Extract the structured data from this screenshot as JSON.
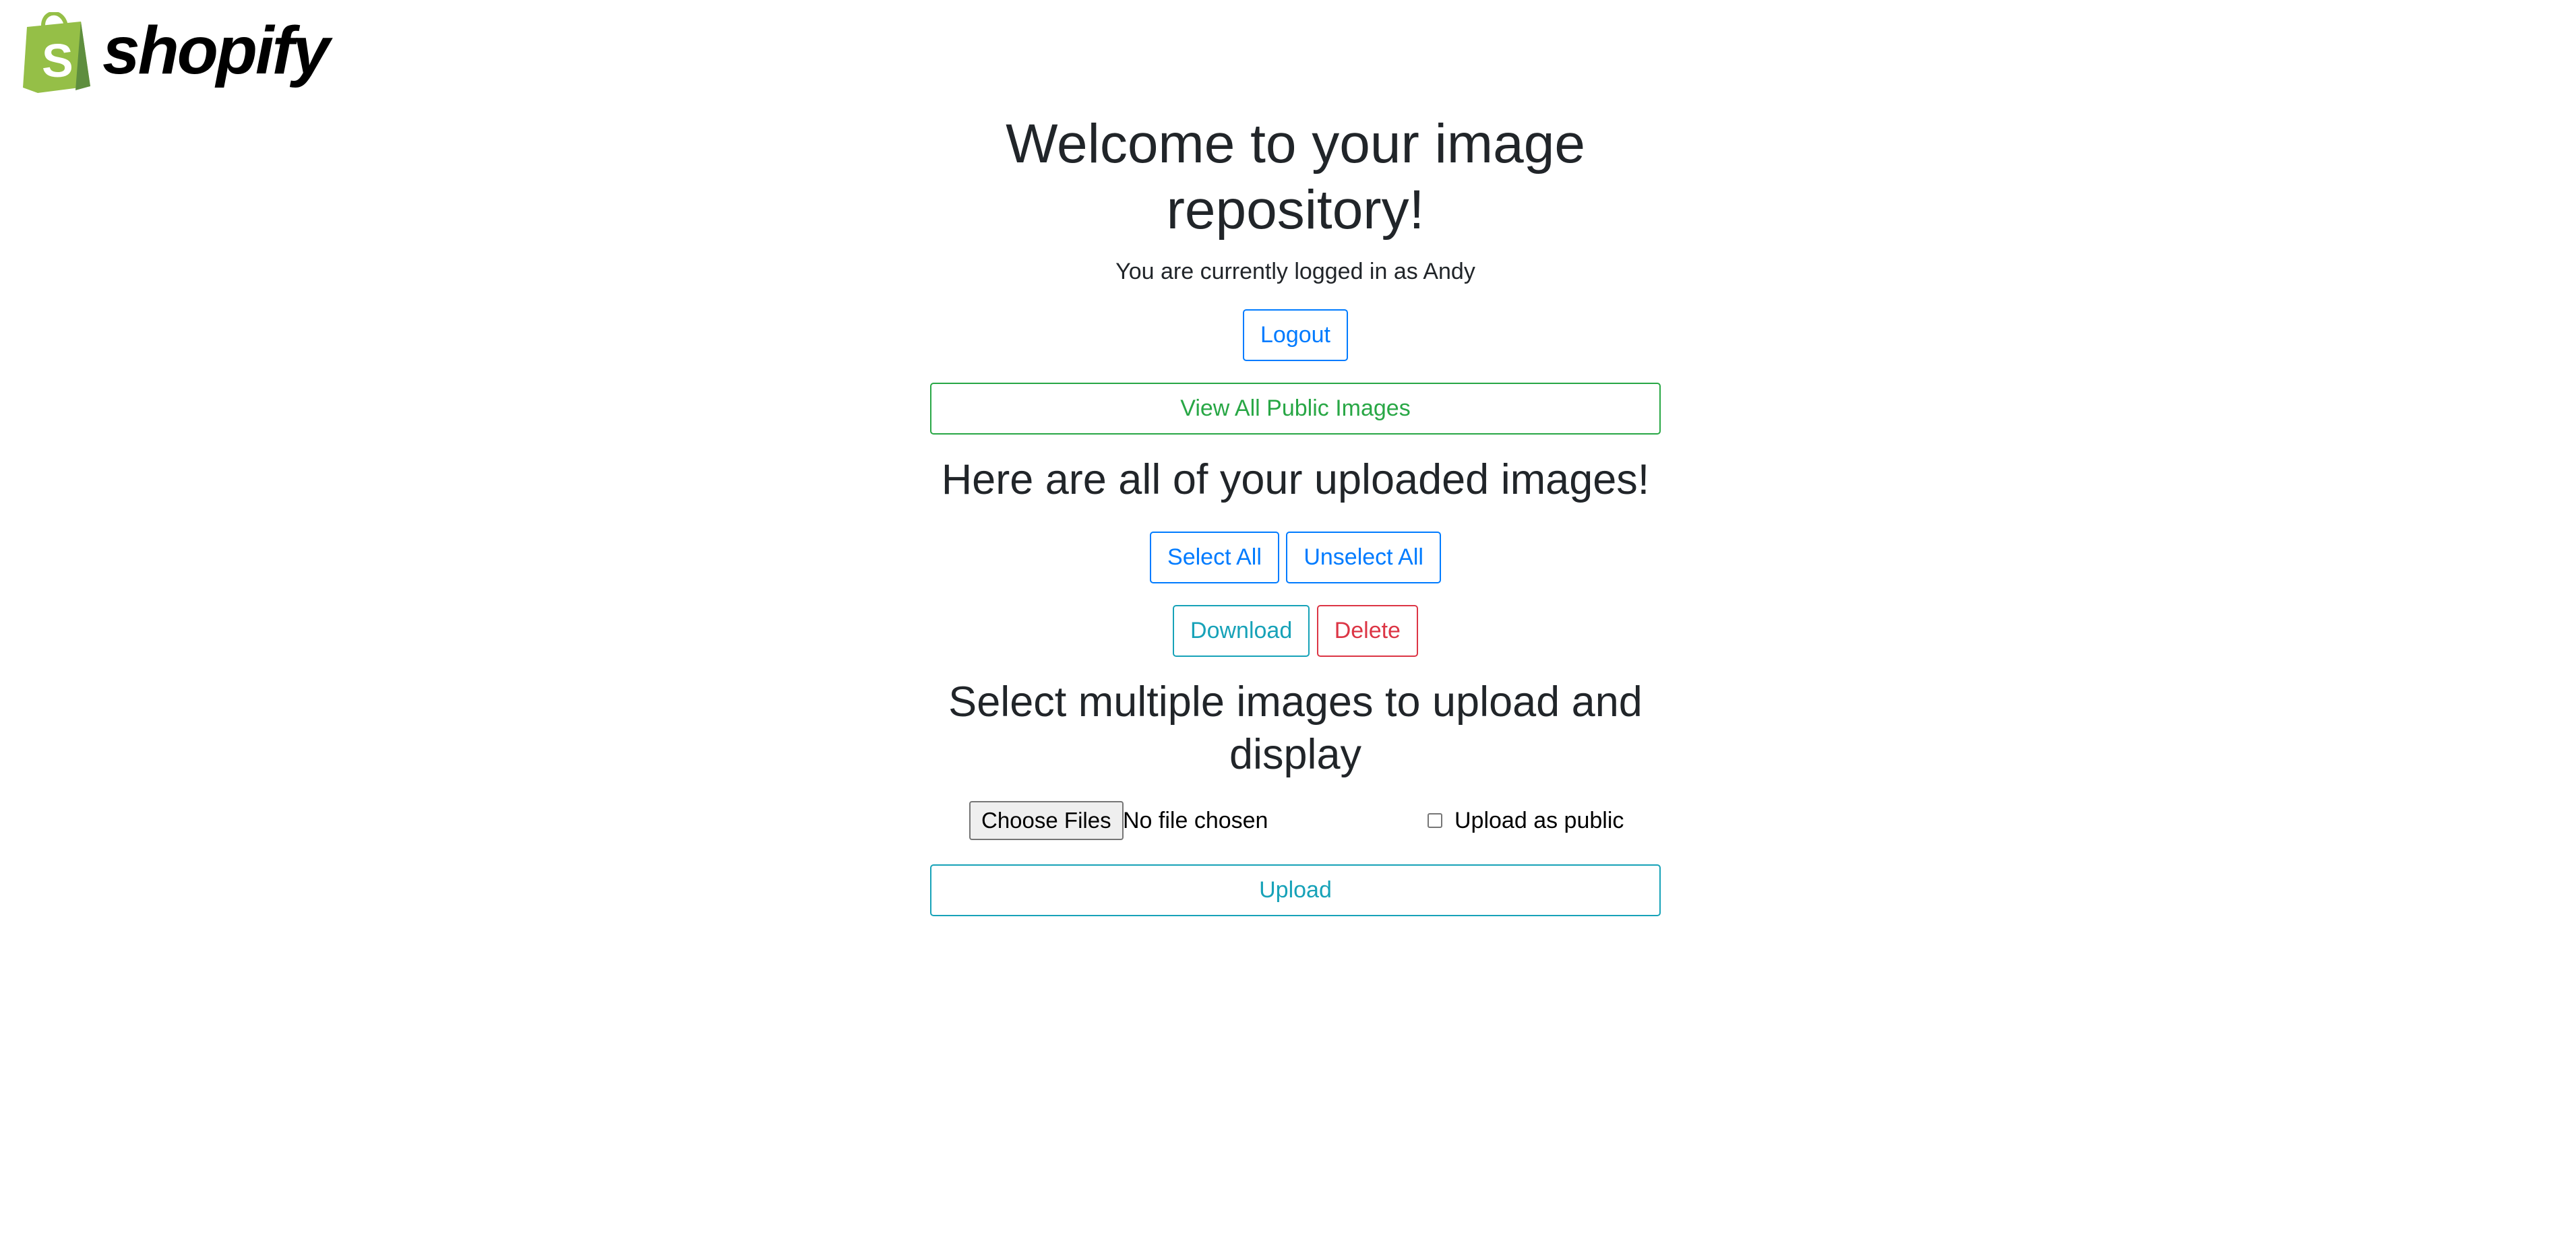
{
  "brand": {
    "name": "shopify",
    "color": "#95bf47"
  },
  "header": {
    "title": "Welcome to your image repository!",
    "subtitle": "You are currently logged in as Andy"
  },
  "actions": {
    "logout_label": "Logout",
    "view_public_label": "View All Public Images"
  },
  "uploaded": {
    "heading": "Here are all of your uploaded images!",
    "select_all_label": "Select All",
    "unselect_all_label": "Unselect All",
    "download_label": "Download",
    "delete_label": "Delete"
  },
  "upload": {
    "heading": "Select multiple images to upload and display",
    "choose_files_label": "Choose Files",
    "file_status": "No file chosen",
    "public_checkbox_label": "Upload as public",
    "public_checked": false,
    "upload_label": "Upload"
  },
  "colors": {
    "primary": "#007bff",
    "success": "#28a745",
    "info": "#17a2b8",
    "danger": "#dc3545"
  }
}
